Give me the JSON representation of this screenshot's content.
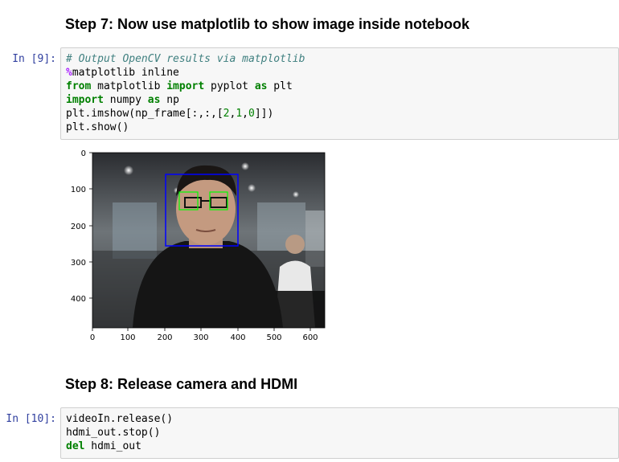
{
  "step7": {
    "heading": "Step 7: Now use matplotlib to show image inside notebook"
  },
  "cell9": {
    "prompt": "In [9]:",
    "lines": {
      "l1": "# Output OpenCV results via matplotlib",
      "l2_magic": "%",
      "l2_rest": "matplotlib inline",
      "l3_from": "from",
      "l3_mod": " matplotlib ",
      "l3_import": "import",
      "l3_name": " pyplot ",
      "l3_as": "as",
      "l3_alias": " plt",
      "l4_import": "import",
      "l4_mod": " numpy ",
      "l4_as": "as",
      "l4_alias": " np",
      "l5_a": "plt.imshow(np_frame[:,:,[",
      "l5_n2": "2",
      "l5_c1": ",",
      "l5_n1": "1",
      "l5_c2": ",",
      "l5_n0": "0",
      "l5_b": "]])",
      "l6": "plt.show()"
    }
  },
  "plot": {
    "x_ticks": [
      "0",
      "100",
      "200",
      "300",
      "400",
      "500",
      "600"
    ],
    "y_ticks": [
      "0",
      "100",
      "200",
      "300",
      "400"
    ],
    "face_box_color": "#0000ff",
    "eye_box_color": "#00ff00"
  },
  "step8": {
    "heading": "Step 8: Release camera and HDMI"
  },
  "cell10": {
    "prompt": "In [10]:",
    "lines": {
      "l1": "videoIn.release()",
      "l2": "hdmi_out.stop()",
      "l3_del": "del",
      "l3_rest": " hdmi_out"
    }
  }
}
